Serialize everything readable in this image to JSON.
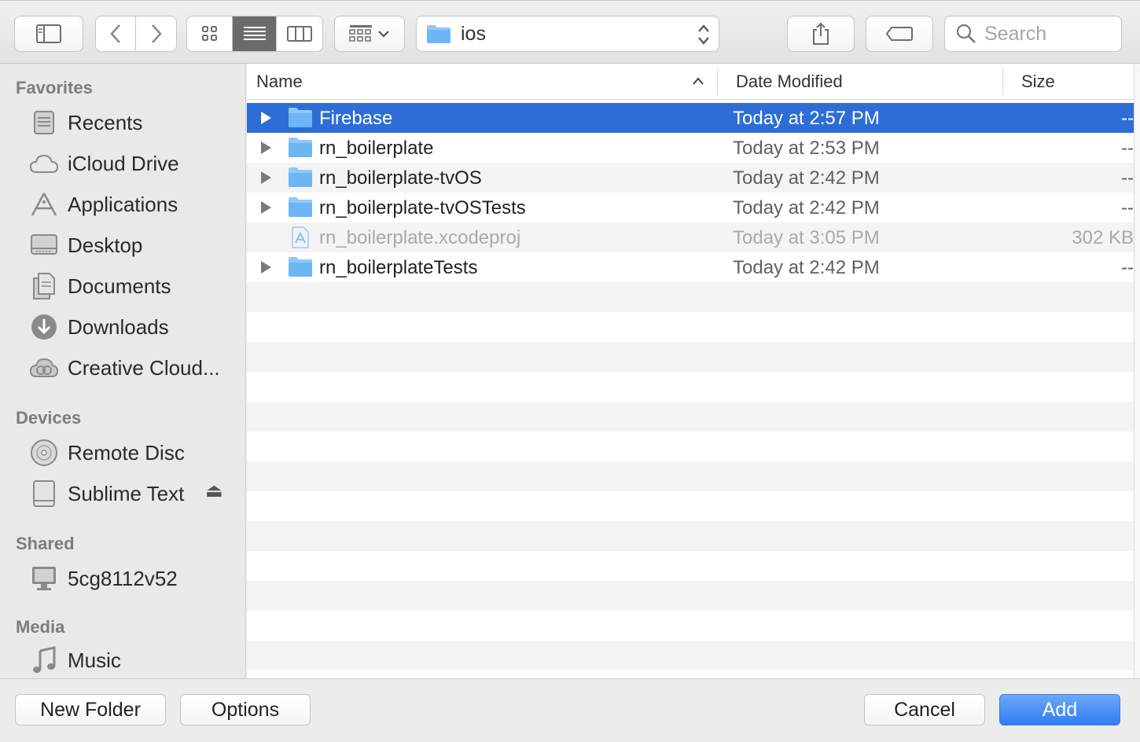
{
  "toolbar": {
    "current_folder": "ios",
    "search_placeholder": "Search"
  },
  "sidebar": {
    "favorites_heading": "Favorites",
    "favorites": [
      {
        "label": "Recents",
        "icon": "recents-icon"
      },
      {
        "label": "iCloud Drive",
        "icon": "cloud-icon"
      },
      {
        "label": "Applications",
        "icon": "applications-icon"
      },
      {
        "label": "Desktop",
        "icon": "desktop-icon"
      },
      {
        "label": "Documents",
        "icon": "documents-icon"
      },
      {
        "label": "Downloads",
        "icon": "downloads-icon"
      },
      {
        "label": "Creative Cloud...",
        "icon": "creative-cloud-icon"
      }
    ],
    "devices_heading": "Devices",
    "devices": [
      {
        "label": "Remote Disc",
        "icon": "disc-icon"
      },
      {
        "label": "Sublime Text",
        "icon": "drive-icon"
      }
    ],
    "shared_heading": "Shared",
    "shared": [
      {
        "label": "5cg8112v52",
        "icon": "computer-icon"
      }
    ],
    "media_heading": "Media",
    "media": [
      {
        "label": "Music",
        "icon": "music-icon"
      }
    ]
  },
  "columns": {
    "name": "Name",
    "date": "Date Modified",
    "size": "Size"
  },
  "files": [
    {
      "name": "Firebase",
      "date": "Today at 2:57 PM",
      "size": "--",
      "type": "folder",
      "selected": true
    },
    {
      "name": "rn_boilerplate",
      "date": "Today at 2:53 PM",
      "size": "--",
      "type": "folder"
    },
    {
      "name": "rn_boilerplate-tvOS",
      "date": "Today at 2:42 PM",
      "size": "--",
      "type": "folder"
    },
    {
      "name": "rn_boilerplate-tvOSTests",
      "date": "Today at 2:42 PM",
      "size": "--",
      "type": "folder"
    },
    {
      "name": "rn_boilerplate.xcodeproj",
      "date": "Today at 3:05 PM",
      "size": "302 KB",
      "type": "xcodeproj",
      "disabled": true
    },
    {
      "name": "rn_boilerplateTests",
      "date": "Today at 2:42 PM",
      "size": "--",
      "type": "folder"
    }
  ],
  "buttons": {
    "new_folder": "New Folder",
    "options": "Options",
    "cancel": "Cancel",
    "add": "Add"
  },
  "colors": {
    "selection": "#2d6dd5",
    "primary_button": "#2f7ef2",
    "folder": "#6cb6f5"
  }
}
